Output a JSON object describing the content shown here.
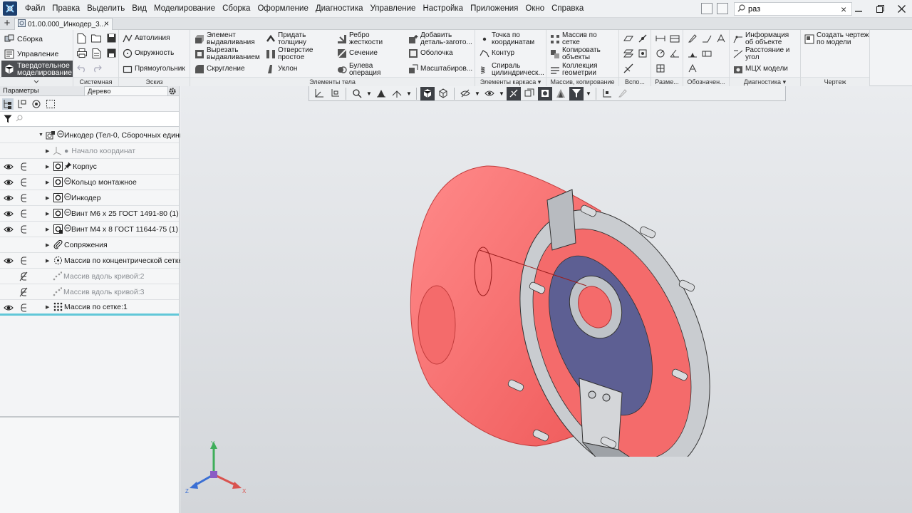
{
  "menubar": {
    "items": [
      "Файл",
      "Правка",
      "Выделить",
      "Вид",
      "Моделирование",
      "Сборка",
      "Оформление",
      "Диагностика",
      "Управление",
      "Настройка",
      "Приложения",
      "Окно",
      "Справка"
    ],
    "search_value": "раз"
  },
  "tabbar": {
    "doc_tab_label": "01.00.000_Инкодер_3..."
  },
  "ribbon": {
    "modes": {
      "assembly": "Сборка",
      "management": "Управление",
      "solid_line1": "Твердотельное",
      "solid_line2": "моделирование"
    },
    "groups": {
      "system": "Системная",
      "sketch": "Эскиз",
      "body": "Элементы тела",
      "frame": "Элементы каркаса",
      "array": "Массив, копирование",
      "aux": "Вспо...",
      "size": "Разме...",
      "designation": "Обозначен...",
      "diagnostics": "Диагностика",
      "drawing": "Чертеж"
    },
    "sketch": {
      "autoline": "Автолиния",
      "circle": "Окружность",
      "rectangle": "Прямоугольник"
    },
    "body": {
      "extrude_l1": "Элемент",
      "extrude_l2": "выдавливания",
      "cut_l1": "Вырезать",
      "cut_l2": "выдавливанием",
      "fillet": "Скругление",
      "thicken_l1": "Придать",
      "thicken_l2": "толщину",
      "hole_l1": "Отверстие",
      "hole_l2": "простое",
      "draft": "Уклон",
      "rib_l1": "Ребро",
      "rib_l2": "жесткости",
      "section": "Сечение",
      "boolean_l1": "Булева",
      "boolean_l2": "операция",
      "add_part_l1": "Добавить",
      "add_part_l2": "деталь-загото...",
      "shell": "Оболочка",
      "scale": "Масштабиров..."
    },
    "frame": {
      "point_l1": "Точка по",
      "point_l2": "координатам",
      "contour": "Контур",
      "spiral_l1": "Спираль",
      "spiral_l2": "цилиндрическ..."
    },
    "array": {
      "grid_l1": "Массив по",
      "grid_l2": "сетке",
      "copy_l1": "Копировать",
      "copy_l2": "объекты",
      "collection_l1": "Коллекция",
      "collection_l2": "геометрии"
    },
    "diagnostics": {
      "info_l1": "Информация",
      "info_l2": "об объекте",
      "distance_l1": "Расстояние и",
      "distance_l2": "угол",
      "mass": "МЦХ модели"
    },
    "drawing": {
      "create_l1": "Создать чертеж",
      "create_l2": "по модели"
    }
  },
  "panel": {
    "tab_params": "Параметры",
    "tab_tree": "Дерево",
    "filter_placeholder": ""
  },
  "tree": {
    "root": "Инкодер (Тел-0, Сборочных едини",
    "origin": "Начало координат",
    "items": [
      {
        "label": "Корпус"
      },
      {
        "label": "Кольцо монтажное"
      },
      {
        "label": "Инкодер"
      },
      {
        "label": "Винт М6 х 25 ГОСТ 1491-80 (1)"
      },
      {
        "label": "Винт М4 х 8 ГОСТ 11644-75 (1)"
      },
      {
        "label": "Сопряжения"
      },
      {
        "label": "Массив по концентрической сетке"
      },
      {
        "label": "Массив вдоль кривой:2"
      },
      {
        "label": "Массив вдоль кривой:3"
      },
      {
        "label": "Массив по сетке:1"
      }
    ]
  },
  "triad": {
    "x": "X",
    "y": "Y",
    "z": "Z"
  },
  "colors": {
    "body": "#f46b6b",
    "ring": "#c9ccd0",
    "disc": "#5d5f93",
    "triad_x": "#d9534f",
    "triad_y": "#3fae5a",
    "triad_z": "#3a6fd4"
  }
}
